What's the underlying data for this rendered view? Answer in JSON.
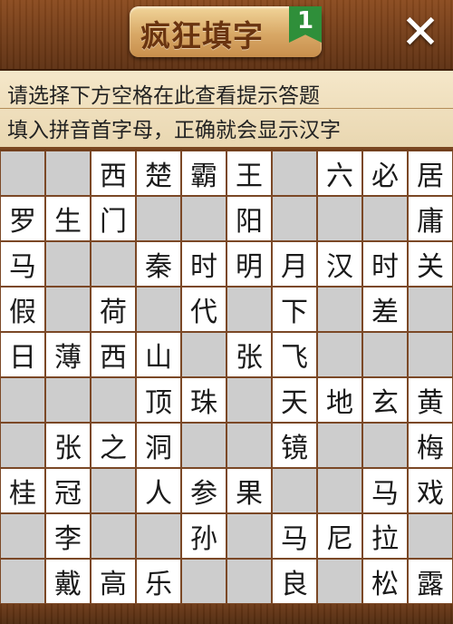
{
  "header": {
    "title": "疯狂填字",
    "level": "1",
    "close_label": "✕"
  },
  "hints": {
    "line1": "请选择下方空格在此查看提示答题",
    "line2": "填入拼音首字母，正确就会显示汉字"
  },
  "grid": [
    [
      "",
      "",
      "西",
      "楚",
      "霸",
      "王",
      "",
      "六",
      "必",
      "居"
    ],
    [
      "罗",
      "生",
      "门",
      "",
      "",
      "阳",
      "",
      "",
      "",
      "庸"
    ],
    [
      "马",
      "",
      "",
      "秦",
      "时",
      "明",
      "月",
      "汉",
      "时",
      "关"
    ],
    [
      "假",
      "",
      "荷",
      "",
      "代",
      "",
      "下",
      "",
      "差",
      ""
    ],
    [
      "日",
      "薄",
      "西",
      "山",
      "",
      "张",
      "飞",
      "",
      "",
      ""
    ],
    [
      "",
      "",
      "",
      "顶",
      "珠",
      "",
      "天",
      "地",
      "玄",
      "黄"
    ],
    [
      "",
      "张",
      "之",
      "洞",
      "",
      "",
      "镜",
      "",
      "",
      "梅"
    ],
    [
      "桂",
      "冠",
      "",
      "人",
      "参",
      "果",
      "",
      "",
      "马",
      "戏"
    ],
    [
      "",
      "李",
      "",
      "",
      "孙",
      "",
      "马",
      "尼",
      "拉",
      ""
    ],
    [
      "",
      "戴",
      "高",
      "乐",
      "",
      "",
      "良",
      "",
      "松",
      "露"
    ]
  ]
}
